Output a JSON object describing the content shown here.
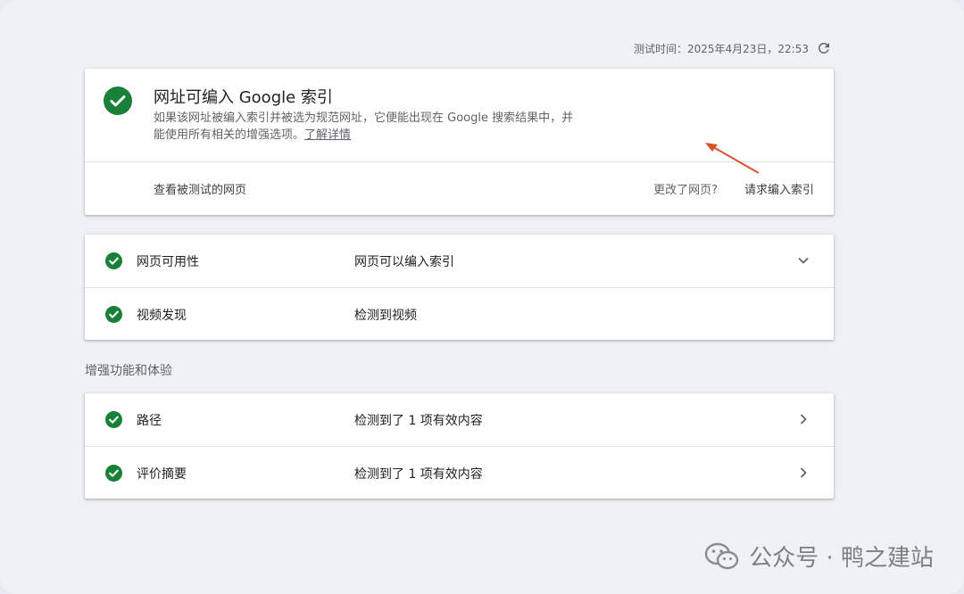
{
  "header": {
    "timestamp": "测试时间：2025年4月23日，22:53"
  },
  "summary": {
    "title": "网址可编入 Google 索引",
    "description_line1": "如果该网址被编入索引并被选为规范网址，它便能出现在 Google 搜索结果中，并",
    "description_line2": "能使用所有相关的增强选项。",
    "learn_more": "了解详情",
    "view_tested_page": "查看被测试的网页",
    "changed_page": "更改了网页?",
    "request_indexing": "请求编入索引"
  },
  "checks": [
    {
      "label": "网页可用性",
      "value": "网页可以编入索引"
    },
    {
      "label": "视频发现",
      "value": "检测到视频"
    }
  ],
  "enhancements": {
    "heading": "增强功能和体验",
    "items": [
      {
        "label": "路径",
        "value": "检测到了 1 项有效内容"
      },
      {
        "label": "评价摘要",
        "value": "检测到了 1 项有效内容"
      }
    ]
  },
  "watermark": {
    "text": "公众号 · 鸭之建站"
  },
  "colors": {
    "success_green": "#188038",
    "annotation_arrow": "#d9532b"
  },
  "icons": {
    "refresh": "refresh-icon",
    "check": "check-circle-icon",
    "expand": "chevron-down-icon",
    "open": "chevron-right-icon",
    "wechat": "wechat-icon"
  }
}
